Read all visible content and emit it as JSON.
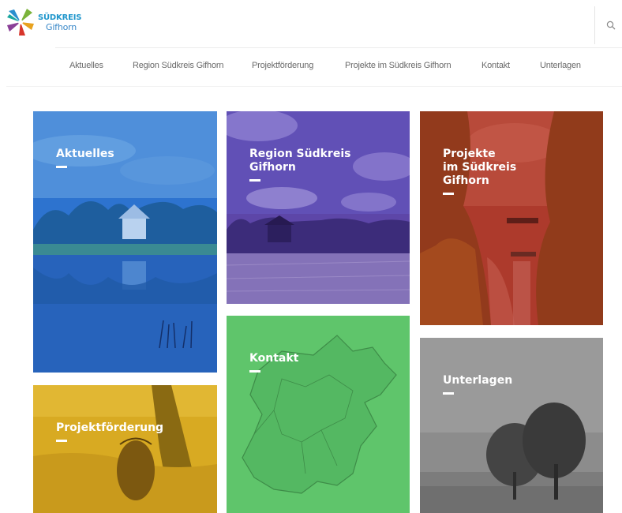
{
  "header": {
    "logo_line1": "SÜDKREIS",
    "logo_line2": "Gifhorn",
    "search_icon": "search-icon"
  },
  "nav": {
    "items": [
      {
        "label": "Aktuelles"
      },
      {
        "label": "Region Südkreis Gifhorn"
      },
      {
        "label": "Projektförderung"
      },
      {
        "label": "Projekte im Südkreis Gifhorn"
      },
      {
        "label": "Kontakt"
      },
      {
        "label": "Unterlagen"
      }
    ]
  },
  "tiles": {
    "aktuelles": {
      "title": "Aktuelles",
      "overlay_color": "#2f6fd0"
    },
    "region": {
      "title": "Region Südkreis\nGifhorn",
      "overlay_color": "#5e46a8"
    },
    "projekte": {
      "title": "Projekte\nim Südkreis\nGifhorn",
      "overlay_color": "#b23a2c"
    },
    "kontakt": {
      "title": "Kontakt",
      "overlay_color": "#5ec46a"
    },
    "projektfoerderung": {
      "title": "Projektförderung",
      "overlay_color": "#d7a821"
    },
    "unterlagen": {
      "title": "Unterlagen",
      "overlay_color": "#8a8a8a"
    }
  }
}
